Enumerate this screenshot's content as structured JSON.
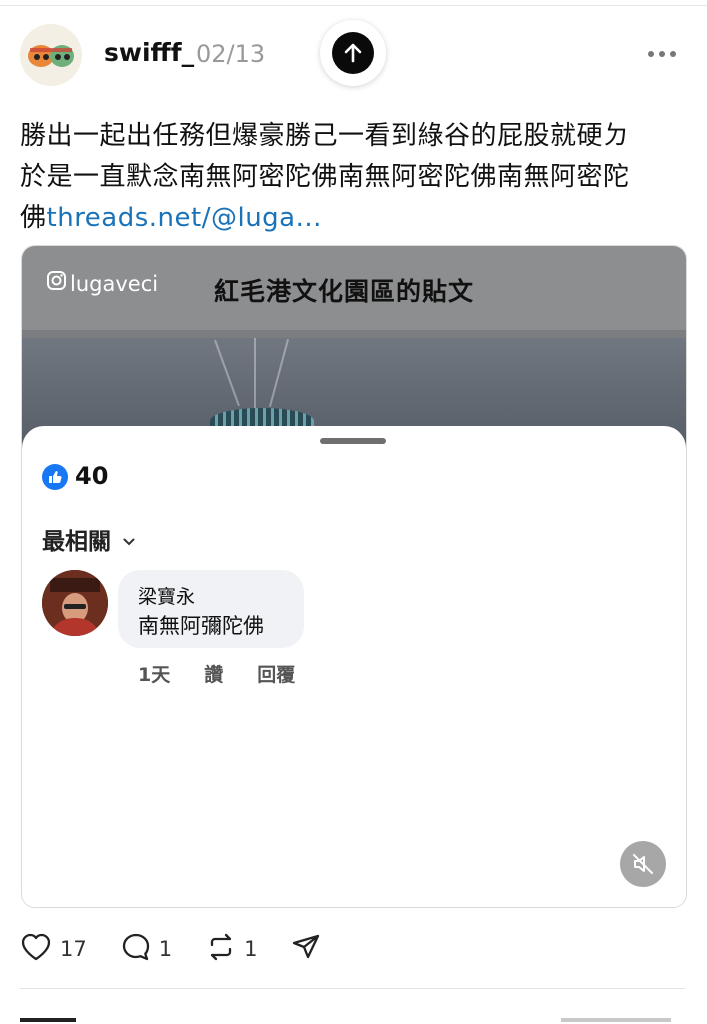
{
  "post": {
    "username": "swifff_",
    "date": "02/13",
    "text_line1": "勝出一起出任務但爆豪勝己一看到綠谷的屁股就硬ㄉ",
    "text_line2": "於是一直默念南無阿密陀佛南無阿密陀佛南無阿密陀",
    "text_line3": "佛",
    "link_text": "threads.net/@luga..."
  },
  "media": {
    "ig_handle": "lugaveci",
    "title": "紅毛港文化園區的貼文",
    "likes_count": "40",
    "sort_label": "最相關",
    "comment": {
      "author": "梁寶永",
      "text": "南無阿彌陀佛",
      "time": "1天",
      "like_label": "讚",
      "reply_label": "回覆"
    }
  },
  "actions": {
    "likes": "17",
    "comments": "1",
    "reposts": "1"
  },
  "icons": [
    "up-arrow-icon",
    "more-icon",
    "instagram-icon",
    "thumbs-up-icon",
    "chevron-down-icon",
    "mute-icon",
    "heart-icon",
    "comment-icon",
    "repost-icon",
    "share-icon"
  ],
  "colors": {
    "link": "#1a73b8",
    "like_badge": "#1877f2",
    "card_header": "#8d8e90"
  }
}
